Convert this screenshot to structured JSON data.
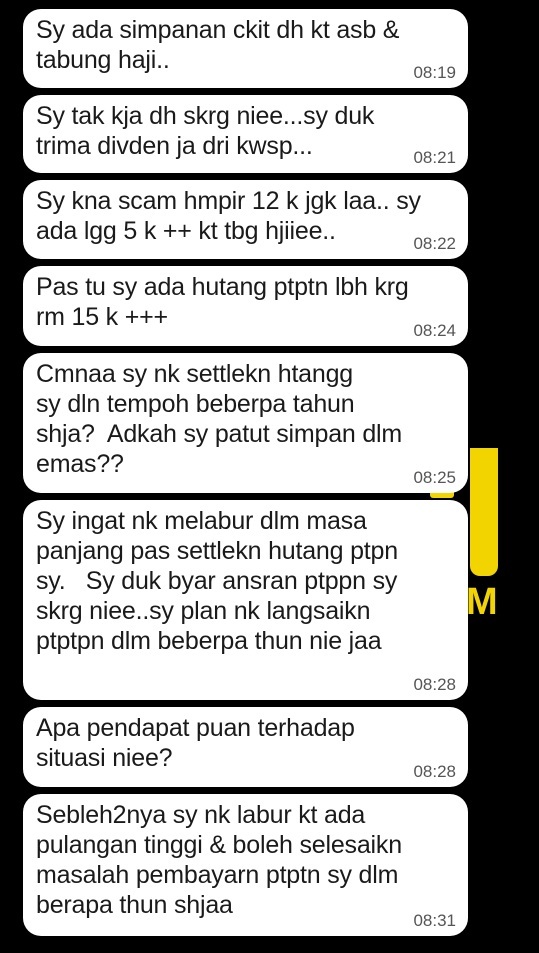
{
  "wallpaper": {
    "letter": "M",
    "accent": "#f2d500"
  },
  "messages": [
    {
      "text": "Sy ada simpanan ckit dh kt asb &\ntabung haji..",
      "time": "08:19"
    },
    {
      "text": "Sy tak kja dh skrg niee...sy duk\ntrima divden ja dri kwsp...",
      "time": "08:21"
    },
    {
      "text": "Sy kna scam hmpir 12 k jgk laa.. sy\nada lgg 5 k ++ kt tbg hjiiee..",
      "time": "08:22"
    },
    {
      "text": "Pas tu sy ada hutang ptptn lbh krg\nrm 15 k +++",
      "time": "08:24"
    },
    {
      "text": "Cmnaa sy nk settlekn htangg\nsy dln tempoh beberpa tahun\nshja?  Adkah sy patut simpan dlm\nemas??",
      "time": "08:25"
    },
    {
      "text": "Sy ingat nk melabur dlm masa\npanjang pas settlekn hutang ptpn\nsy.   Sy duk byar ansran ptppn sy\nskrg niee..sy plan nk langsaikn\nptptpn dlm beberpa thun nie jaa",
      "time": "08:28"
    },
    {
      "text": "Apa pendapat puan terhadap\nsituasi niee?",
      "time": "08:28"
    },
    {
      "text": "Sebleh2nya sy nk labur kt ada\npulangan tinggi & boleh selesaikn\nmasalah pembayarn ptptn sy dlm\nberapa thun shjaa",
      "time": "08:31"
    }
  ]
}
